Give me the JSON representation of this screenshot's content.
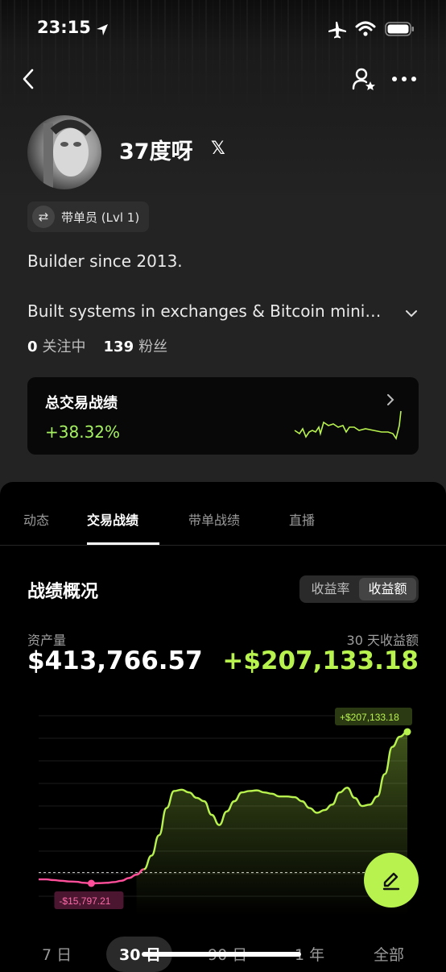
{
  "status_bar": {
    "time": "23:15"
  },
  "profile": {
    "name": "37度呀",
    "social_icon": "x-logo",
    "badge_label": "带单员 (Lvl 1)",
    "bio_line1": "Builder since 2013.",
    "bio_line2": "Built systems in exchanges & Bitcoin mini…",
    "following_count": "0",
    "following_label": "关注中",
    "followers_count": "139",
    "followers_label": "粉丝"
  },
  "performance_card": {
    "title": "总交易战绩",
    "value": "+38.32%"
  },
  "tabs": [
    {
      "label": "动态",
      "active": false
    },
    {
      "label": "交易战绩",
      "active": true
    },
    {
      "label": "带单战绩",
      "active": false
    },
    {
      "label": "直播",
      "active": false
    }
  ],
  "overview": {
    "title": "战绩概况",
    "toggle_options": [
      "收益率",
      "收益额"
    ],
    "toggle_selected": "收益额",
    "assets_label": "资产量",
    "assets_value": "$413,766.57",
    "pnl_label": "30 天收益额",
    "pnl_value": "+$207,133.18"
  },
  "chart_data": {
    "type": "area",
    "max_label": "+$207,133.18",
    "min_label": "-$15,797.21",
    "line_color": "#b8f24e",
    "negative_color": "#ff4f9a",
    "points": [
      -10000,
      -10000,
      -11000,
      -12000,
      -13000,
      -13500,
      -15000,
      -15797,
      -15500,
      -15000,
      -14000,
      -12000,
      -8000,
      -3000,
      5000,
      25000,
      55000,
      95000,
      120000,
      122000,
      118000,
      110000,
      105000,
      85000,
      70000,
      90000,
      105000,
      118000,
      120000,
      121000,
      118000,
      116000,
      112000,
      112000,
      111000,
      105000,
      95000,
      88000,
      92000,
      100000,
      118000,
      125000,
      110000,
      98000,
      100000,
      112000,
      145000,
      185000,
      200000,
      207133
    ]
  },
  "time_ranges": [
    "7 日",
    "30 日",
    "90 日",
    "1 年",
    "全部"
  ],
  "selected_range": "30 日",
  "colors": {
    "accent": "#b8f24e",
    "positive": "#a5f060",
    "negative": "#ff4f9a"
  }
}
